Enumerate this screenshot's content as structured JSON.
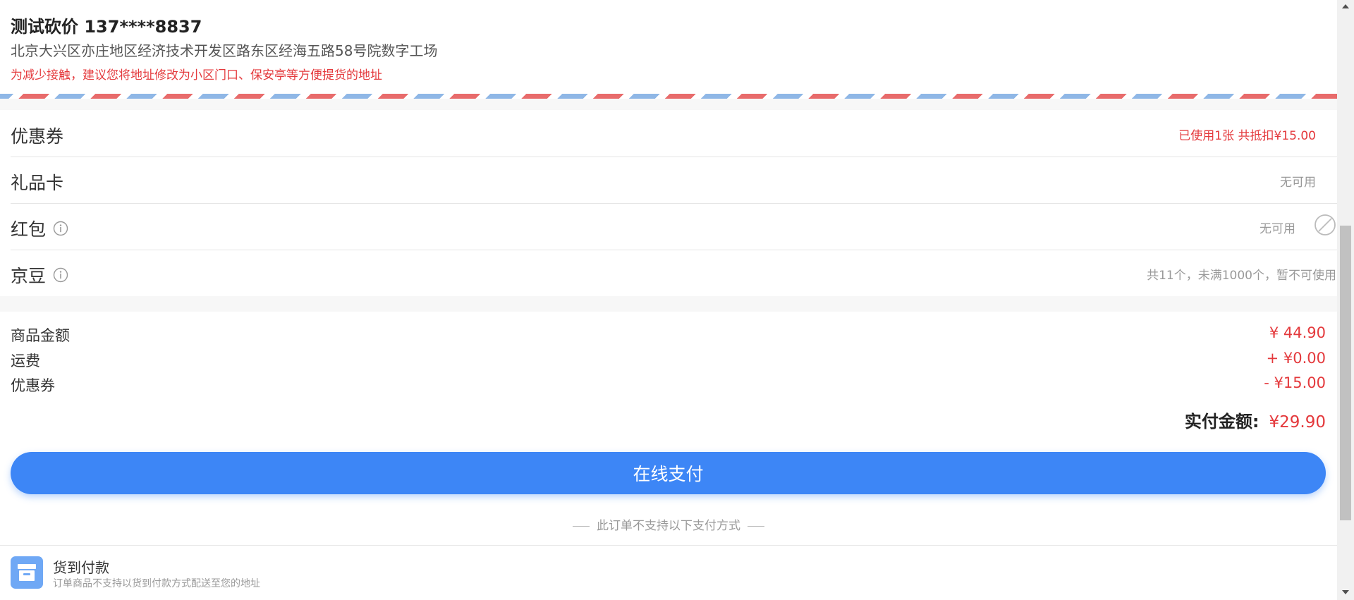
{
  "address": {
    "name_phone": "测试砍价 137****8837",
    "detail": "北京大兴区亦庄地区经济技术开发区路东区经海五路58号院数字工场",
    "tip": "为减少接触，建议您将地址修改为小区门口、保安亭等方便提货的地址"
  },
  "discount_rows": {
    "coupon": {
      "label": "优惠券",
      "value": "已使用1张 共抵扣¥15.00"
    },
    "gift_card": {
      "label": "礼品卡",
      "value": "无可用"
    },
    "red_packet": {
      "label": "红包",
      "value": "无可用"
    },
    "jd_beans": {
      "label": "京豆",
      "value": "共11个，未满1000个，暂不可使用"
    }
  },
  "icons": {
    "info": "info-circle-icon",
    "disabled": "prohibited-icon",
    "cod": "cash-on-delivery-box-icon"
  },
  "summary": {
    "goods_label": "商品金额",
    "goods_value": "¥ 44.90",
    "shipping_label": "运费",
    "shipping_value": "+ ¥0.00",
    "coupon_label": "优惠券",
    "coupon_value": "- ¥15.00"
  },
  "total": {
    "label": "实付金额:",
    "value": "¥29.90"
  },
  "pay_button": {
    "label": "在线支付"
  },
  "unsupported_note": "此订单不支持以下支付方式",
  "cod": {
    "title": "货到付款",
    "desc": "订单商品不支持以货到付款方式配送至您的地址"
  },
  "colors": {
    "accent_red": "#e4393c",
    "primary_blue": "#3d86f6",
    "stripe_red": "#e86b6b",
    "stripe_blue": "#8fb7e6"
  }
}
